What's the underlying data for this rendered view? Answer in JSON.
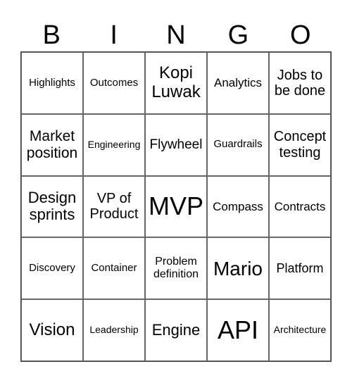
{
  "header": [
    "B",
    "I",
    "N",
    "G",
    "O"
  ],
  "cells": [
    [
      "Highlights",
      "Outcomes",
      "Kopi Luwak",
      "Analytics",
      "Jobs to be done"
    ],
    [
      "Market position",
      "Engineering",
      "Flywheel",
      "Guardrails",
      "Concept testing"
    ],
    [
      "Design sprints",
      "VP of Product",
      "MVP",
      "Compass",
      "Contracts"
    ],
    [
      "Discovery",
      "Container",
      "Problem definition",
      "Mario",
      "Platform"
    ],
    [
      "Vision",
      "Leadership",
      "Engine",
      "API",
      "Architecture"
    ]
  ]
}
